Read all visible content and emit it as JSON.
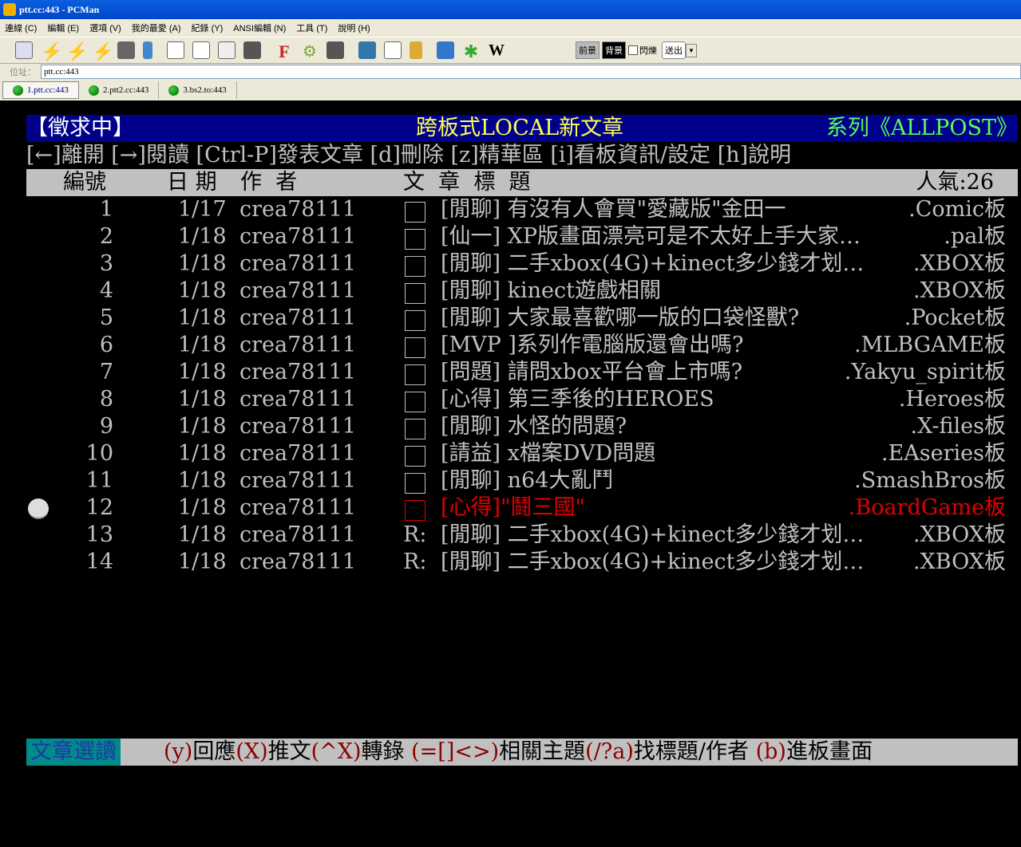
{
  "window": {
    "title": "ptt.cc:443 - PCMan"
  },
  "menu": [
    "連線 (C)",
    "編輯 (E)",
    "選項 (V)",
    "我的最愛 (A)",
    "紀錄 (Y)",
    "ANSI編輯 (N)",
    "工具 (T)",
    "說明 (H)"
  ],
  "toolbar": {
    "fg_label": "前景",
    "bg_label": "背景",
    "blink_label": "閃爍",
    "send_label": "送出",
    "wiki_label": "W"
  },
  "address": {
    "label": "位址：",
    "value": "ptt.cc:443"
  },
  "tabs": [
    "1.ptt.cc:443",
    "2.ptt2.cc:443",
    "3.bs2.to:443"
  ],
  "terminal": {
    "header": {
      "left": "【徵求中】",
      "center": "跨板式LOCAL新文章",
      "right": "系列《ALLPOST》"
    },
    "help": "[←]離開 [→]閱讀 [Ctrl-P]發表文章 [d]刪除 [z]精華區 [i]看板資訊/設定 [h]說明",
    "columns": {
      "num": "編號",
      "date": "日 期",
      "author": "作  者",
      "title": "文  章  標  題",
      "popularity": "人氣:26"
    },
    "rows": [
      {
        "num": "1",
        "date": "1/17",
        "author": "crea78111",
        "mark": "",
        "title": "[閒聊] 有沒有人會買\"愛藏版\"金田一",
        "board": ".Comic板"
      },
      {
        "num": "2",
        "date": "1/18",
        "author": "crea78111",
        "mark": "",
        "title": "[仙一] XP版畫面漂亮可是不太好上手大家…",
        "board": ".pal板"
      },
      {
        "num": "3",
        "date": "1/18",
        "author": "crea78111",
        "mark": "",
        "title": "[閒聊] 二手xbox(4G)+kinect多少錢才划…",
        "board": ".XBOX板"
      },
      {
        "num": "4",
        "date": "1/18",
        "author": "crea78111",
        "mark": "",
        "title": "[閒聊] kinect遊戲相關",
        "board": ".XBOX板"
      },
      {
        "num": "5",
        "date": "1/18",
        "author": "crea78111",
        "mark": "",
        "title": "[閒聊] 大家最喜歡哪一版的口袋怪獸?",
        "board": ".Pocket板"
      },
      {
        "num": "6",
        "date": "1/18",
        "author": "crea78111",
        "mark": "",
        "title": "[MVP ]系列作電腦版還會出嗎?",
        "board": ".MLBGAME板"
      },
      {
        "num": "7",
        "date": "1/18",
        "author": "crea78111",
        "mark": "",
        "title": "[問題] 請問xbox平台會上市嗎?",
        "board": ".Yakyu_spirit板"
      },
      {
        "num": "8",
        "date": "1/18",
        "author": "crea78111",
        "mark": "",
        "title": "[心得] 第三季後的HEROES",
        "board": ".Heroes板"
      },
      {
        "num": "9",
        "date": "1/18",
        "author": "crea78111",
        "mark": "",
        "title": "[閒聊] 水怪的問題?",
        "board": ".X-files板"
      },
      {
        "num": "10",
        "date": "1/18",
        "author": "crea78111",
        "mark": "",
        "title": "[請益] x檔案DVD問題",
        "board": ".EAseries板"
      },
      {
        "num": "11",
        "date": "1/18",
        "author": "crea78111",
        "mark": "",
        "title": "[閒聊] n64大亂鬥",
        "board": ".SmashBros板"
      },
      {
        "num": "12",
        "date": "1/18",
        "author": "crea78111",
        "mark": "",
        "title": "[心得]\"鬪三國\"",
        "board": ".BoardGame板"
      },
      {
        "num": "13",
        "date": "1/18",
        "author": "crea78111",
        "mark": "R:",
        "title": "[閒聊] 二手xbox(4G)+kinect多少錢才划…",
        "board": ".XBOX板"
      },
      {
        "num": "14",
        "date": "1/18",
        "author": "crea78111",
        "mark": "R:",
        "title": "[閒聊] 二手xbox(4G)+kinect多少錢才划…",
        "board": ".XBOX板"
      }
    ],
    "footer": {
      "mode": "文章選讀",
      "keys": [
        {
          "k": "(y)",
          "t": "回應"
        },
        {
          "k": "(X)",
          "t": "推文"
        },
        {
          "k": "(^X)",
          "t": "轉錄 "
        },
        {
          "k": "(=[]<>)",
          "t": "相關主題"
        },
        {
          "k": "(/?a)",
          "t": "找標題/作者 "
        },
        {
          "k": "(b)",
          "t": "進板畫面"
        }
      ]
    }
  },
  "colors": {
    "header_bg": "#00008b",
    "header_title": "#ffff55",
    "header_right": "#55ff55",
    "highlight": "#e00000",
    "footer_mode_bg": "#008b8b",
    "footer_bg": "#c0c0c0",
    "footer_key": "#8b0000"
  }
}
